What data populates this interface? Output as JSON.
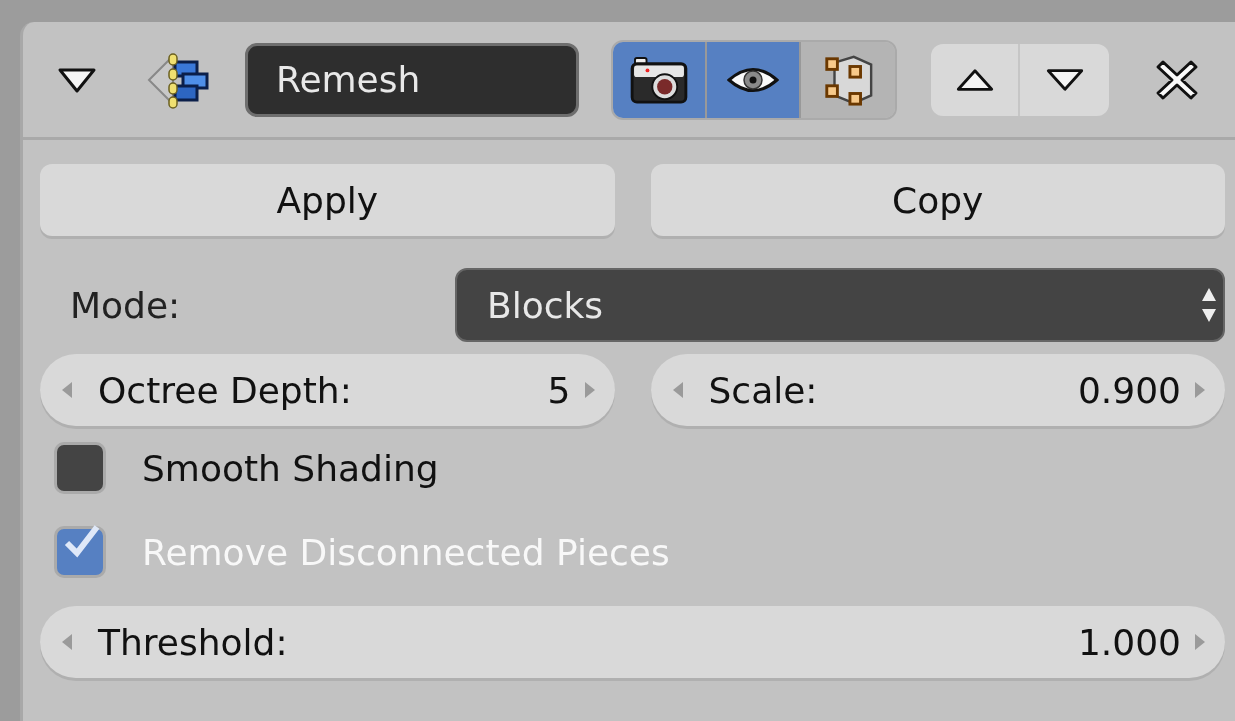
{
  "panel": {
    "expanded": true,
    "name": "Remesh",
    "toggles": [
      {
        "kind": "render",
        "on": true
      },
      {
        "kind": "viewport",
        "on": true
      },
      {
        "kind": "editmode",
        "on": false
      }
    ]
  },
  "actions": [
    "Apply",
    "Copy"
  ],
  "mode": {
    "label": "Mode:",
    "value": "Blocks"
  },
  "fields": [
    {
      "label": "Octree Depth:",
      "value": "5"
    },
    {
      "label": "Scale:",
      "value": "0.900"
    }
  ],
  "checkboxes": [
    {
      "label": "Smooth Shading",
      "checked": false
    },
    {
      "label": "Remove Disconnected Pieces",
      "checked": true
    }
  ],
  "threshold": {
    "label": "Threshold:",
    "value": "1.000"
  }
}
